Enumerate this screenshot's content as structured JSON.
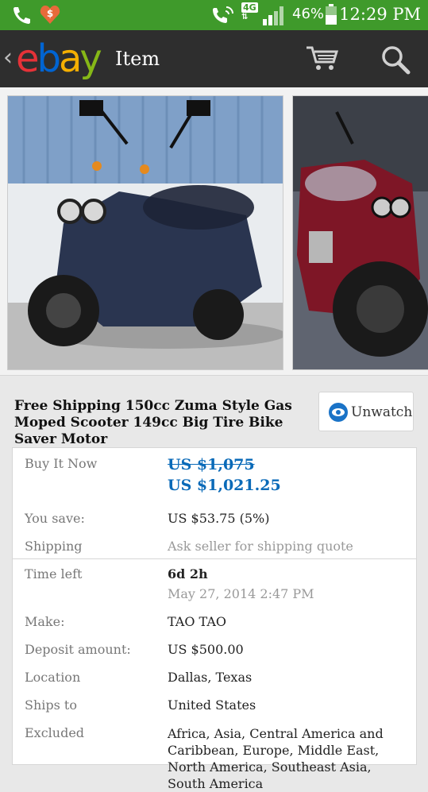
{
  "status_bar": {
    "battery": "46%",
    "time": "12:29 PM",
    "network": "4G"
  },
  "app_bar": {
    "logo": {
      "e": "e",
      "b": "b",
      "a": "a",
      "y": "y"
    },
    "title": "Item"
  },
  "item": {
    "title": "Free Shipping 150cc Zuma Style Gas Moped Scooter 149cc Big Tire Bike Saver Motor",
    "watch_label": "Unwatch"
  },
  "details": {
    "buy_it_now_label": "Buy It Now",
    "original_price": "US $1,075",
    "price": "US $1,021.25",
    "you_save_label": "You save:",
    "you_save_value": "US $53.75 (5%)",
    "shipping_label": "Shipping",
    "shipping_value": "Ask seller for shipping quote",
    "time_left_label": "Time left",
    "time_left_value": "6d 2h",
    "end_date": "May 27, 2014 2:47 PM",
    "make_label": "Make:",
    "make_value": "TAO TAO",
    "deposit_label": "Deposit amount:",
    "deposit_value": "US $500.00",
    "location_label": "Location",
    "location_value": "Dallas, Texas",
    "ships_to_label": "Ships to",
    "ships_to_value": "United States",
    "excluded_label": "Excluded",
    "excluded_value": "Africa, Asia, Central America and Caribbean, Europe, Middle East, North America, Southeast Asia, South America"
  },
  "colors": {
    "status_bar": "#3f9a2b",
    "app_bar": "#2e2e2e",
    "price": "#0a6ab8"
  },
  "icons": [
    "phone-icon",
    "deal-icon",
    "call-icon",
    "signal-icon",
    "battery-icon",
    "back-icon",
    "cart-icon",
    "search-icon",
    "eye-icon"
  ]
}
